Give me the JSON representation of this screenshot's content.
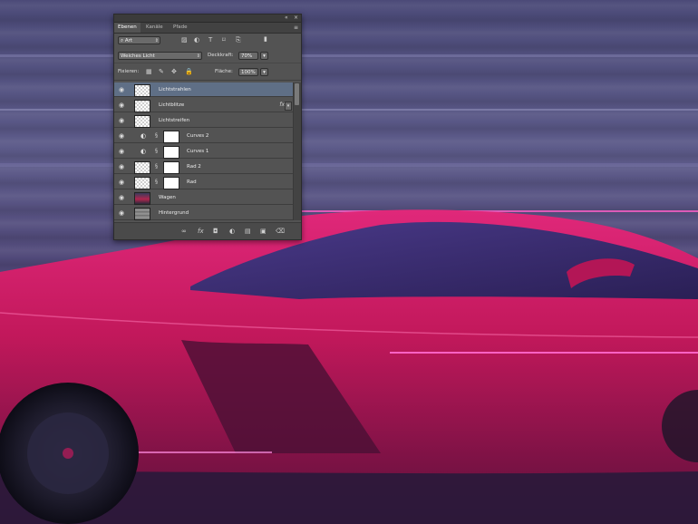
{
  "panel": {
    "tabs": [
      "Ebenen",
      "Kanäle",
      "Pfade"
    ],
    "active_tab": 0,
    "filter_select": "Art",
    "blend_mode": "Weiches Licht",
    "opacity_label": "Deckkraft:",
    "opacity_value": "70%",
    "lock_label": "Fixieren:",
    "fill_label": "Fläche:",
    "fill_value": "100%",
    "fx_label": "fx",
    "layers": [
      {
        "name": "Lichtstrahlen",
        "selected": true
      },
      {
        "name": "Lichtblitze",
        "fx": true
      },
      {
        "name": "Lichtstreifen"
      },
      {
        "name": "Curves 2",
        "adjustment": true
      },
      {
        "name": "Curves 1",
        "adjustment": true
      },
      {
        "name": "Rad 2",
        "mask": true
      },
      {
        "name": "Rad",
        "mask": true
      },
      {
        "name": "Wagen"
      },
      {
        "name": "Hintergrund"
      }
    ]
  },
  "icons": {
    "collapse": "«",
    "close": "×",
    "panel_menu": "≡",
    "search": "⌕",
    "eye": "👁",
    "chain": "⛓",
    "adjustment": "◐",
    "link": "∞",
    "new_layer": "▣",
    "folder": "▤",
    "trash": "🗑"
  },
  "colors": {
    "panel_bg": "#535353",
    "selected_row": "#5f6f86",
    "car_red": "#c2185b"
  }
}
